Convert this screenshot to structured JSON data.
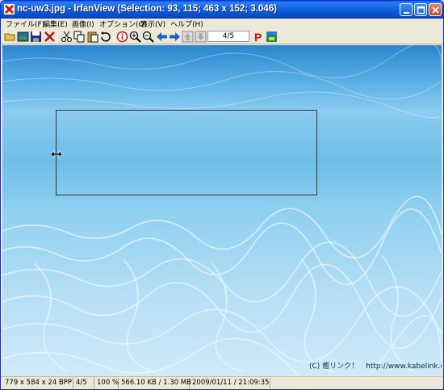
{
  "window": {
    "title": "nc-uw3.jpg - IrfanView (Selection: 93, 115; 463 x 152; 3.046)"
  },
  "menu": {
    "items": [
      "ファイル(F)",
      "編集(E)",
      "画像(I)",
      "オプション(O)",
      "表示(V)",
      "ヘルプ(H)"
    ]
  },
  "toolbar": {
    "page_indicator": "4/5",
    "icons": [
      "open-folder",
      "thumbnails",
      "save",
      "delete",
      "cut",
      "copy",
      "paste",
      "undo",
      "info",
      "zoom-in",
      "zoom-out",
      "previous",
      "next",
      "up",
      "down",
      "paypal",
      "palette"
    ]
  },
  "image": {
    "watermark": "(C) 癒リンク！　http://www.kabelink.com"
  },
  "status": {
    "dimensions": "779 x 584 x 24 BPP",
    "index": "4/5",
    "zoom": "100 %",
    "size": "566.10 KB / 1.30 MB",
    "datetime": "2009/01/11 / 21:09:35"
  },
  "colors": {
    "title_bar": "#0a58e0",
    "selection_border": "#333333"
  }
}
